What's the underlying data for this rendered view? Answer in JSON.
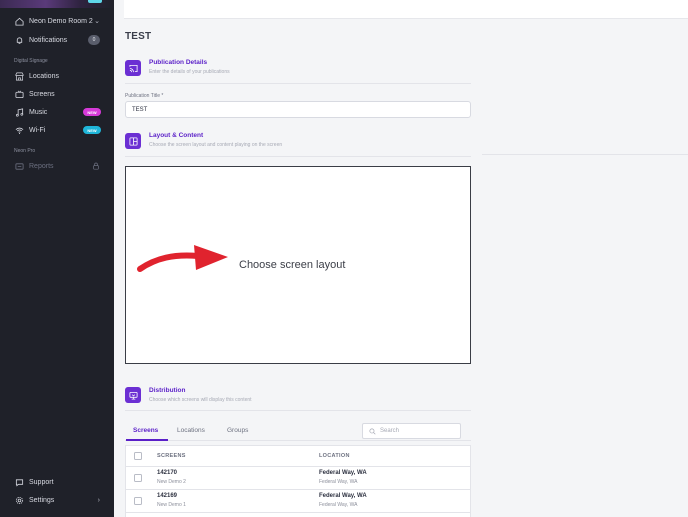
{
  "sidebar": {
    "room_label": "Neon Demo Room 2",
    "notifications_label": "Notifications",
    "notifications_count": "0",
    "section_digital_signage": "Digital Signage",
    "locations_label": "Locations",
    "screens_label": "Screens",
    "music_label": "Music",
    "music_badge": "NEW",
    "wifi_label": "Wi-Fi",
    "wifi_badge": "NEW",
    "section_neon_pro": "Neon Pro",
    "reports_label": "Reports",
    "support_label": "Support",
    "settings_label": "Settings"
  },
  "page": {
    "title": "TEST"
  },
  "publication": {
    "title": "Publication Details",
    "subtitle": "Enter the details of your publications",
    "field_label": "Publication Title *",
    "field_value": "TEST"
  },
  "layout": {
    "title": "Layout & Content",
    "subtitle": "Choose the screen layout and content playing on the screen",
    "prompt": "Choose screen layout"
  },
  "distribution": {
    "title": "Distribution",
    "subtitle": "Choose which screens will display this content",
    "tabs": [
      "Screens",
      "Locations",
      "Groups"
    ],
    "search_placeholder": "Search",
    "columns": [
      "SCREENS",
      "LOCATION"
    ],
    "rows": [
      {
        "id": "142170",
        "name": "New Demo 2",
        "location": "Federal Way, WA",
        "location_sub": "Federal Way, WA"
      },
      {
        "id": "142169",
        "name": "New Demo 1",
        "location": "Federal Way, WA",
        "location_sub": "Federal Way, WA"
      }
    ]
  },
  "colors": {
    "accent": "#5a1fc8",
    "sidebar_bg": "#1f2129",
    "badge_music": "#d63ad8",
    "badge_wifi": "#1fb6d9",
    "arrow": "#e0232e"
  }
}
